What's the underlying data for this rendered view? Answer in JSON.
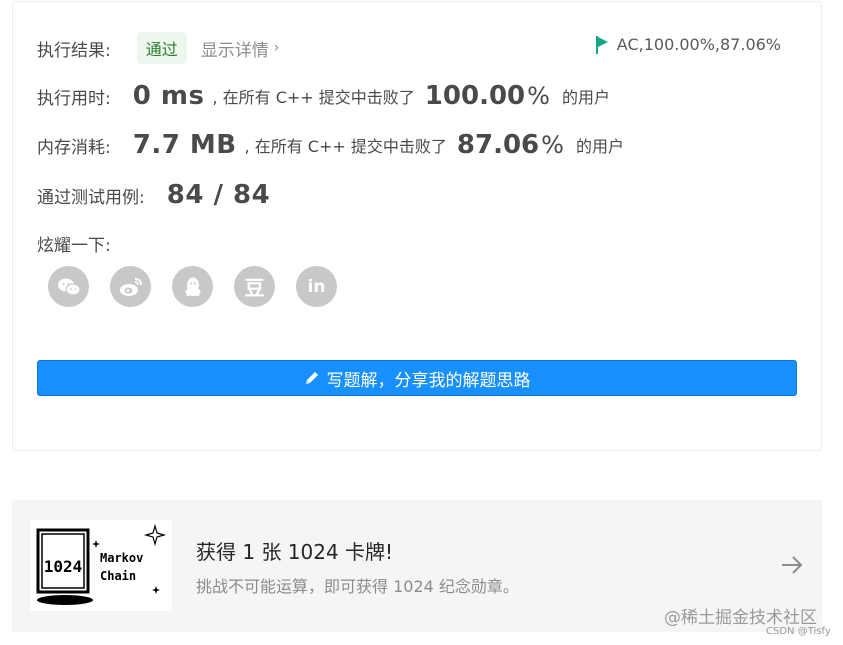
{
  "result": {
    "label": "执行结果:",
    "status": "通过",
    "detail": "显示详情",
    "detail_chevron": "›",
    "ac": "AC,100.00%,87.06%"
  },
  "time": {
    "label": "执行用时:",
    "value": "0 ms",
    "mid": ", 在所有 C++ 提交中击败了",
    "pct": "100.00",
    "pct_sign": "%",
    "tail": "的用户"
  },
  "memory": {
    "label": "内存消耗:",
    "value": "7.7 MB",
    "mid": ", 在所有 C++ 提交中击败了",
    "pct": "87.06",
    "pct_sign": "%",
    "tail": "的用户"
  },
  "tests": {
    "label": "通过测试用例:",
    "value": "84 / 84"
  },
  "share": {
    "label": "炫耀一下:",
    "icons": [
      "wechat-icon",
      "weibo-icon",
      "qq-icon",
      "douban-icon",
      "linkedin-icon"
    ],
    "douban_glyph": "豆",
    "linkedin_glyph": "in"
  },
  "write_button": "写题解，分享我的解题思路",
  "promo": {
    "title": "获得 1 张 1024 卡牌!",
    "subtitle": "挑战不可能运算，即可获得 1024 纪念勋章。",
    "card_tile": "1024",
    "card_text_1": "Markov",
    "card_text_2": "Chain"
  },
  "watermark": "@稀土掘金技术社区",
  "csdn": "CSDN @Tisfy",
  "colors": {
    "accent": "#1890ff",
    "pass_green": "#2e7d32",
    "ac_flag": "#12a58c",
    "icon_gray": "#c8c8c8"
  }
}
